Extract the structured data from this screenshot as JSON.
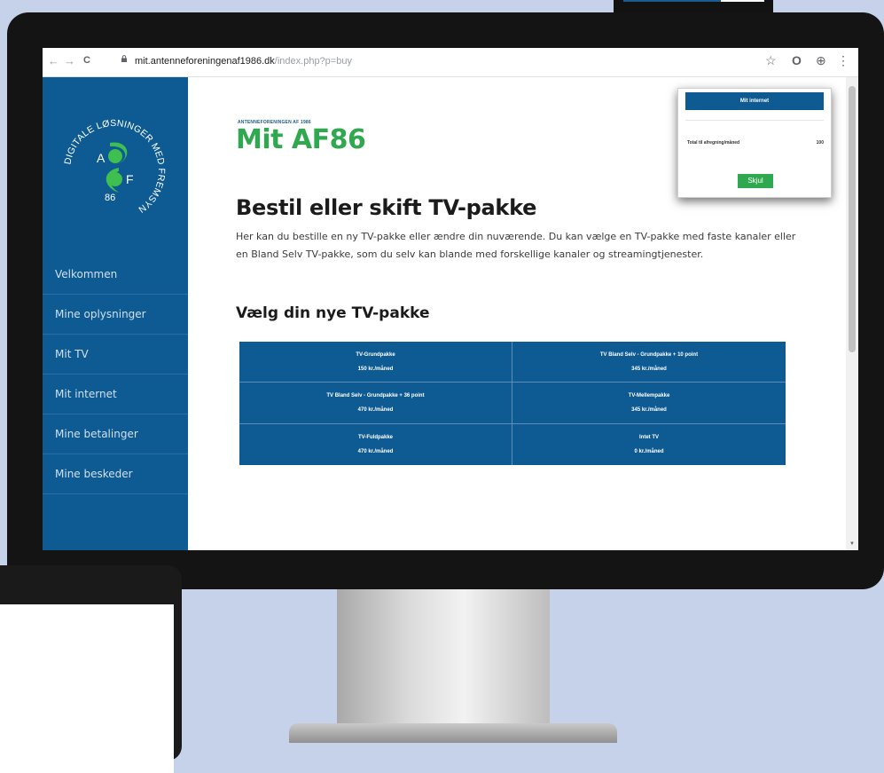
{
  "browser": {
    "url_host": "mit.antenneforeningenaf1986.dk",
    "url_path": "/index.php?p=buy",
    "nav_back": "←",
    "nav_forward": "→",
    "nav_reload": "C",
    "icon_star": "☆",
    "icon_account": "⊕",
    "icon_menu": "⋮"
  },
  "logo": {
    "ring_top": "DIGITALE LØSNINGER MED FREMSYN",
    "letter_a": "A",
    "letter_f": "F",
    "number": "86"
  },
  "sidebar": {
    "items": [
      {
        "label": "Velkommen"
      },
      {
        "label": "Mine oplysninger"
      },
      {
        "label": "Mit TV"
      },
      {
        "label": "Mit internet"
      },
      {
        "label": "Mine betalinger"
      },
      {
        "label": "Mine beskeder"
      }
    ]
  },
  "brand": {
    "small": "ANTENNEFORENINGEN AF 1986",
    "title": "Mit AF86"
  },
  "main": {
    "title": "Bestil eller skift TV-pakke",
    "intro": "Her kan du bestille en ny TV-pakke eller ændre din nuværende. Du kan vælge en TV-pakke med faste kanaler eller en Bland Selv TV-pakke, som du selv kan blande med forskellige kanaler og streamingtjenester.",
    "section_title": "Vælg din nye TV-pakke",
    "packages": [
      {
        "name": "TV-Grundpakke",
        "price": "150 kr./måned"
      },
      {
        "name": "TV Bland Selv - Grundpakke + 10 point",
        "price": "345 kr./måned"
      },
      {
        "name": "TV Bland Selv - Grundpakke + 36 point",
        "price": "470 kr./måned"
      },
      {
        "name": "TV-Mellempakke",
        "price": "345 kr./måned"
      },
      {
        "name": "TV-Fuldpakke",
        "price": "470 kr./måned"
      },
      {
        "name": "Intet TV",
        "price": "0 kr./måned"
      }
    ]
  },
  "panel": {
    "header": "Mit internet",
    "total_label": "Total til afregning/måned",
    "total_value": "100",
    "button": "Skjul"
  },
  "colors": {
    "brand_blue": "#0e5a93",
    "brand_green": "#2fa84f",
    "background": "#c6d2ea"
  }
}
